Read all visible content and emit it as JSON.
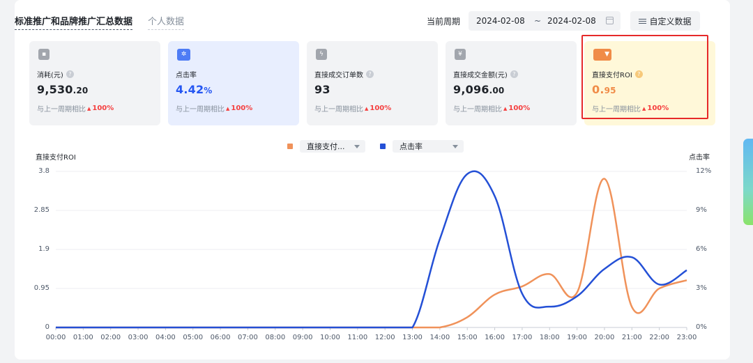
{
  "tabs": [
    {
      "label": "标准推广和品牌推广汇总数据",
      "active": true
    },
    {
      "label": "个人数据",
      "active": false
    }
  ],
  "period": {
    "label": "当前周期",
    "start": "2024-02-08",
    "separator": "~",
    "end": "2024-02-08"
  },
  "custom_button_label": "自定义数据",
  "compare_prefix": "与上一周期相比",
  "help_glyph": "?",
  "up_glyph": "▲",
  "cards": [
    {
      "label": "消耗(元)",
      "value_int": "9,530",
      "value_dec": ".20",
      "change": "100%",
      "icon": "wallet-icon",
      "glyph": "▪"
    },
    {
      "label": "点击率",
      "value_int": "4.42",
      "value_dec": "%",
      "change": "100%",
      "icon": "cursor-click-icon",
      "glyph": "✲"
    },
    {
      "label": "直接成交订单数",
      "value_int": "93",
      "value_dec": "",
      "change": "100%",
      "icon": "order-icon",
      "glyph": "ϟ"
    },
    {
      "label": "直接成交金额(元)",
      "value_int": "9,096",
      "value_dec": ".00",
      "change": "100%",
      "icon": "yen-icon",
      "glyph": "¥"
    },
    {
      "label": "直接支付ROI",
      "value_int": "0.",
      "value_dec": "95",
      "change": "100%",
      "icon": "funnel-icon",
      "glyph": "▼"
    }
  ],
  "legend": [
    {
      "name": "直接支付...",
      "color": "#f0925a"
    },
    {
      "name": "点击率",
      "color": "#2450d6"
    }
  ],
  "colors": {
    "highlight": "#e62929",
    "roi": "#f0925a",
    "ctr": "#2450d6"
  },
  "chart_data": {
    "type": "line",
    "x": [
      "00:00",
      "01:00",
      "02:00",
      "03:00",
      "04:00",
      "05:00",
      "06:00",
      "07:00",
      "08:00",
      "09:00",
      "10:00",
      "11:00",
      "12:00",
      "13:00",
      "14:00",
      "15:00",
      "16:00",
      "17:00",
      "18:00",
      "19:00",
      "20:00",
      "21:00",
      "22:00",
      "23:00"
    ],
    "y_left_label": "直接支付ROI",
    "y_right_label": "点击率",
    "y_left_ticks": [
      "0",
      "0.95",
      "1.9",
      "2.85",
      "3.8"
    ],
    "y_right_ticks": [
      "0%",
      "3%",
      "6%",
      "9%",
      "12%"
    ],
    "y_left_range": [
      0,
      3.8
    ],
    "y_right_range": [
      0,
      12
    ],
    "grid": true,
    "series": [
      {
        "name": "直接支付...",
        "axis": "left",
        "values": [
          0,
          0,
          0,
          0,
          0,
          0,
          0,
          0,
          0,
          0,
          0,
          0,
          0,
          0,
          0,
          0.25,
          0.8,
          1.0,
          1.3,
          0.85,
          3.62,
          0.5,
          0.95,
          1.15
        ]
      },
      {
        "name": "点击率",
        "axis": "right",
        "values": [
          0,
          0,
          0,
          0,
          0,
          0,
          0,
          0,
          0,
          0,
          0,
          0,
          0,
          0,
          6.8,
          11.8,
          10.1,
          2.6,
          1.6,
          2.4,
          4.5,
          5.4,
          3.3,
          4.4
        ]
      }
    ]
  }
}
